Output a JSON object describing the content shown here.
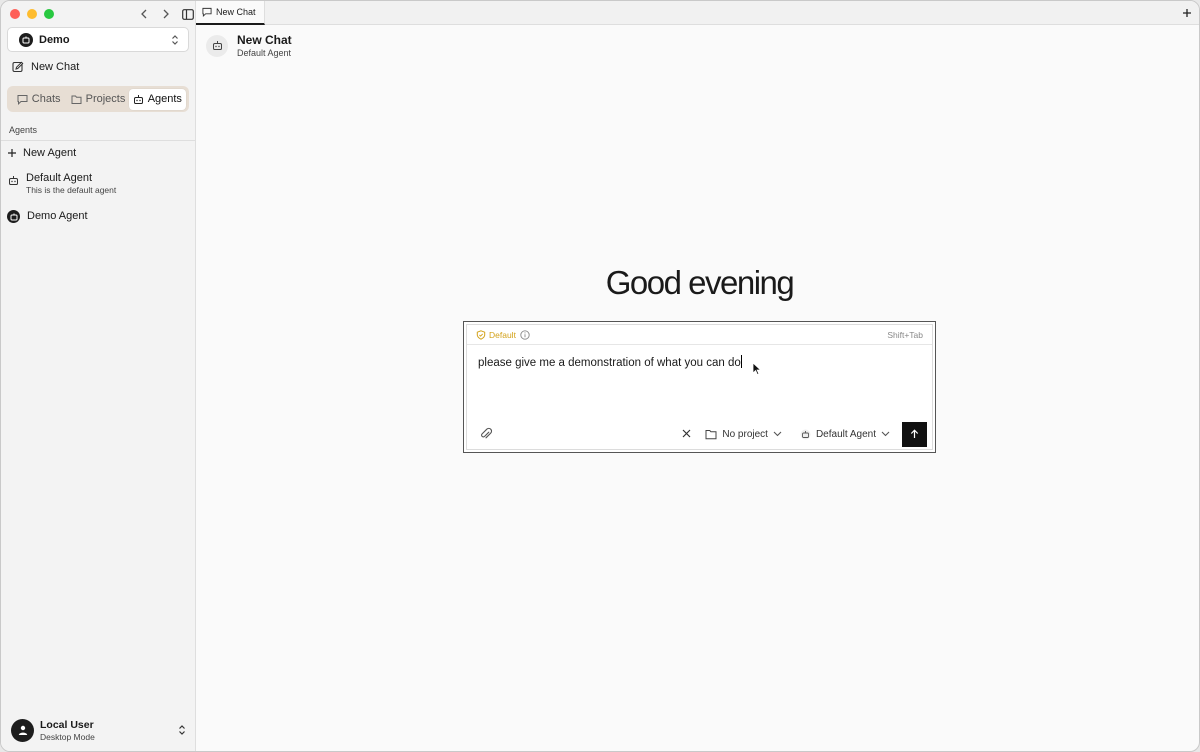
{
  "window": {
    "traffic_lights": [
      "close",
      "minimize",
      "maximize"
    ]
  },
  "sidebar": {
    "workspace": {
      "name": "Demo"
    },
    "new_chat_label": "New Chat",
    "tabs": [
      {
        "label": "Chats",
        "icon": "chat-icon",
        "active": false
      },
      {
        "label": "Projects",
        "icon": "folder-icon",
        "active": false
      },
      {
        "label": "Agents",
        "icon": "bot-icon",
        "active": true
      }
    ],
    "section_label": "Agents",
    "new_agent_label": "New Agent",
    "agents": [
      {
        "name": "Default Agent",
        "description": "This is the default agent",
        "icon": "bot-icon"
      },
      {
        "name": "Demo Agent",
        "description": "",
        "icon": "workspace-bot-icon"
      }
    ],
    "user": {
      "name": "Local User",
      "mode": "Desktop Mode"
    }
  },
  "tabbar": {
    "active_tab_label": "New Chat"
  },
  "header": {
    "title": "New Chat",
    "subtitle": "Default Agent"
  },
  "main": {
    "greeting": "Good evening",
    "composer": {
      "mode_label": "Default",
      "shortcut_hint": "Shift+Tab",
      "input_text": "please give me a demonstration of what you can do",
      "project_label": "No project",
      "agent_label": "Default Agent"
    }
  },
  "colors": {
    "mode_accent": "#d3a21a",
    "send_button": "#111111",
    "tabs_bg": "#e7ded4"
  }
}
